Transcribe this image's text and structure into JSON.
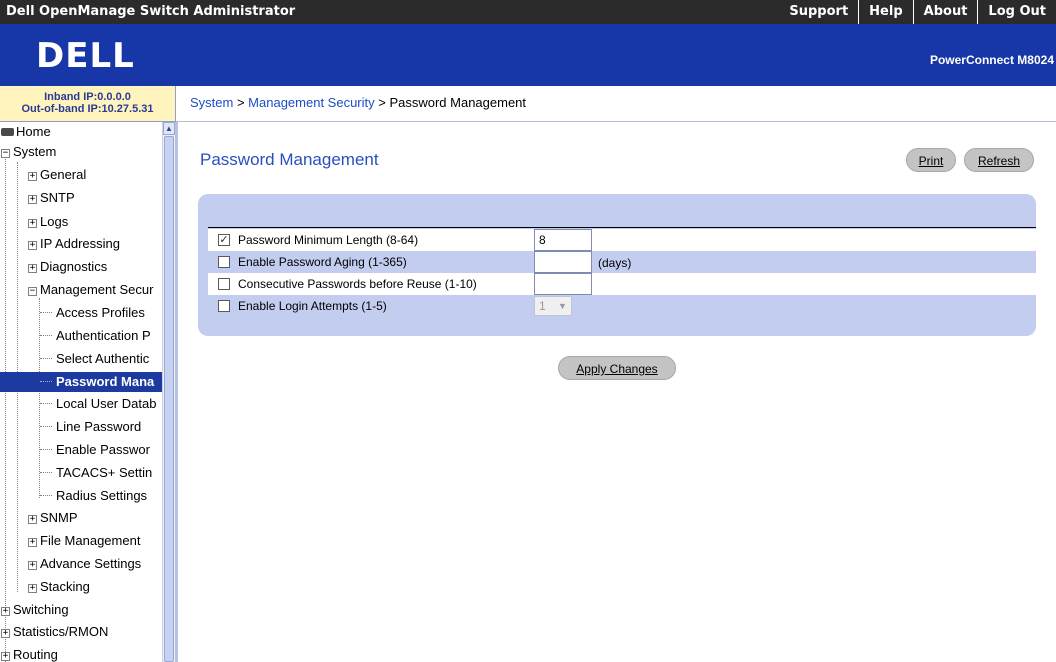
{
  "topbar": {
    "title": "Dell OpenManage Switch Administrator",
    "links": [
      "Support",
      "Help",
      "About",
      "Log Out"
    ]
  },
  "banner": {
    "logo": "DELL",
    "product": "PowerConnect M8024"
  },
  "ipinfo": {
    "inband": "Inband IP:0.0.0.0",
    "outofband": "Out-of-band IP:10.27.5.31"
  },
  "breadcrumb": {
    "system": "System",
    "sep1": " > ",
    "mgmt": "Management Security",
    "sep2": " > ",
    "current": "Password Management"
  },
  "tree": {
    "home": "Home",
    "system": "System",
    "general": "General",
    "sntp": "SNTP",
    "logs": "Logs",
    "ip_addressing": "IP Addressing",
    "diagnostics": "Diagnostics",
    "mgmt_security": "Management Secur",
    "access_profiles": "Access Profiles",
    "auth_profiles": "Authentication P",
    "select_auth": "Select Authentic",
    "password_mgmt": "Password Mana",
    "local_user_db": "Local User Datab",
    "line_password": "Line Password",
    "enable_password": "Enable Passwor",
    "tacacs": "TACACS+ Settin",
    "radius": "Radius Settings",
    "snmp": "SNMP",
    "file_mgmt": "File Management",
    "advance_settings": "Advance Settings",
    "stacking": "Stacking",
    "switching": "Switching",
    "statistics": "Statistics/RMON",
    "routing": "Routing"
  },
  "main": {
    "title": "Password Management",
    "print_label": "Print",
    "refresh_label": "Refresh",
    "apply_label": "Apply Changes",
    "rows": [
      {
        "label": "Password Minimum Length (8-64)",
        "checked": "✓",
        "value": "8"
      },
      {
        "label": "Enable Password Aging (1-365)",
        "checked": "",
        "value": "",
        "unit": "(days)"
      },
      {
        "label": "Consecutive Passwords before Reuse (1-10)",
        "checked": "",
        "value": ""
      },
      {
        "label": "Enable Login Attempts (1-5)",
        "checked": "",
        "selected": "1"
      }
    ]
  }
}
